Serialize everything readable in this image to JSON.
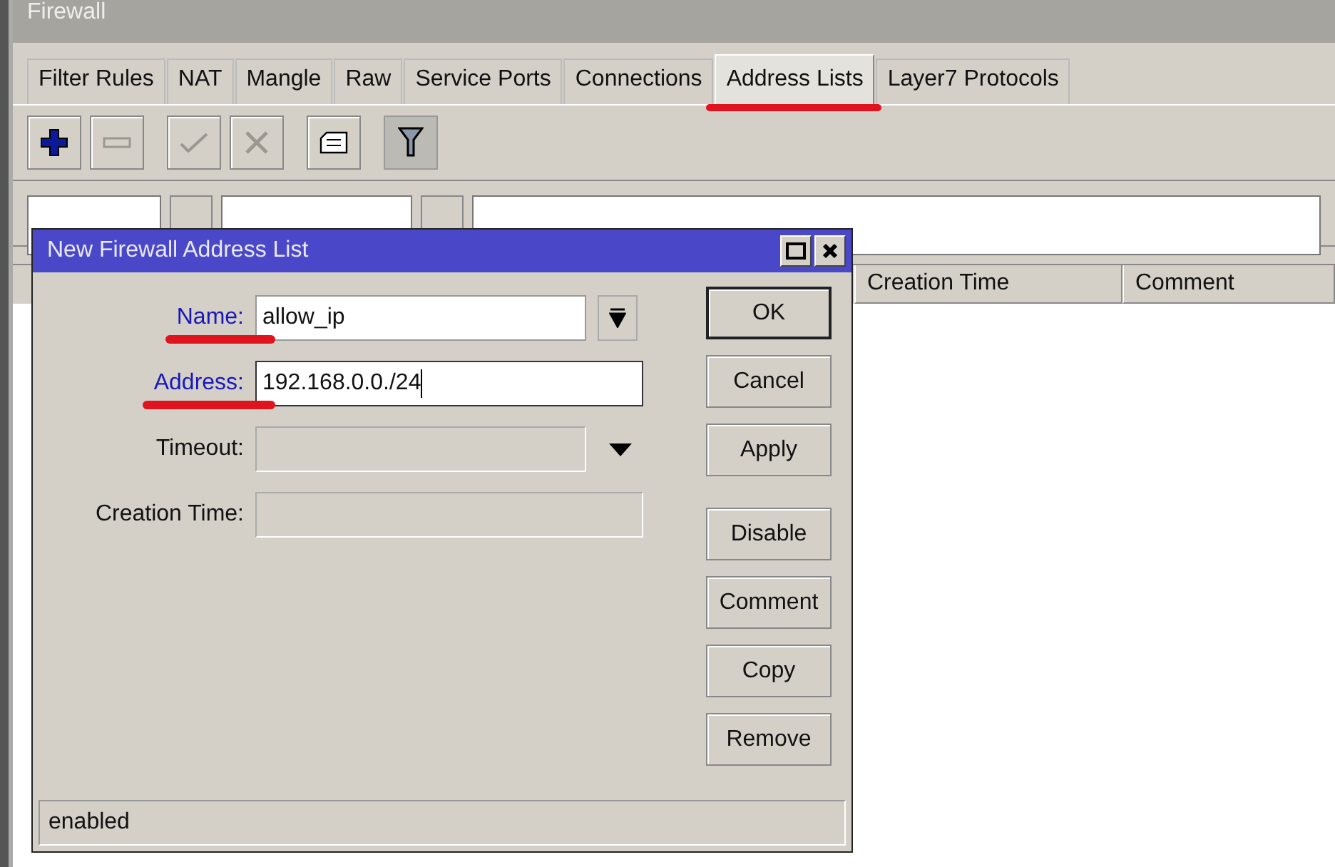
{
  "window": {
    "title": "Firewall"
  },
  "tabs": [
    {
      "label": "Filter Rules",
      "selected": false,
      "highlighted": false
    },
    {
      "label": "NAT",
      "selected": false,
      "highlighted": false
    },
    {
      "label": "Mangle",
      "selected": false,
      "highlighted": false
    },
    {
      "label": "Raw",
      "selected": false,
      "highlighted": false
    },
    {
      "label": "Service Ports",
      "selected": false,
      "highlighted": false
    },
    {
      "label": "Connections",
      "selected": false,
      "highlighted": false
    },
    {
      "label": "Address Lists",
      "selected": true,
      "highlighted": true
    },
    {
      "label": "Layer7 Protocols",
      "selected": false,
      "highlighted": false
    }
  ],
  "toolbar": [
    {
      "kind": "add",
      "disabled": false,
      "pressed": false
    },
    {
      "kind": "remove",
      "disabled": true,
      "pressed": false
    },
    {
      "kind": "enable",
      "disabled": true,
      "pressed": false
    },
    {
      "kind": "disable",
      "disabled": true,
      "pressed": false
    },
    {
      "kind": "comment",
      "disabled": false,
      "pressed": false
    },
    {
      "kind": "filter",
      "disabled": false,
      "pressed": true
    }
  ],
  "table": {
    "columns": [
      "Creation Time",
      "Comment"
    ]
  },
  "dialog": {
    "title": "New Firewall Address List",
    "fields": [
      {
        "label": "Name:",
        "value": "allow_ip",
        "kind": "combo",
        "link": true,
        "highlighted": true,
        "disabled": false,
        "focused": false
      },
      {
        "label": "Address:",
        "value": "192.168.0.0./24",
        "kind": "text",
        "link": true,
        "highlighted": true,
        "disabled": false,
        "focused": true
      },
      {
        "label": "Timeout:",
        "kind": "dropdown",
        "link": false,
        "highlighted": false,
        "disabled": true,
        "focused": false
      },
      {
        "label": "Creation Time:",
        "kind": "text",
        "link": false,
        "highlighted": false,
        "disabled": true,
        "focused": false
      }
    ],
    "button_groups": [
      [
        {
          "label": "OK",
          "default": true
        },
        {
          "label": "Cancel",
          "default": false
        },
        {
          "label": "Apply",
          "default": false
        }
      ],
      [
        {
          "label": "Disable",
          "default": false
        },
        {
          "label": "Comment",
          "default": false
        },
        {
          "label": "Copy",
          "default": false
        },
        {
          "label": "Remove",
          "default": false
        }
      ]
    ],
    "status": "enabled"
  }
}
